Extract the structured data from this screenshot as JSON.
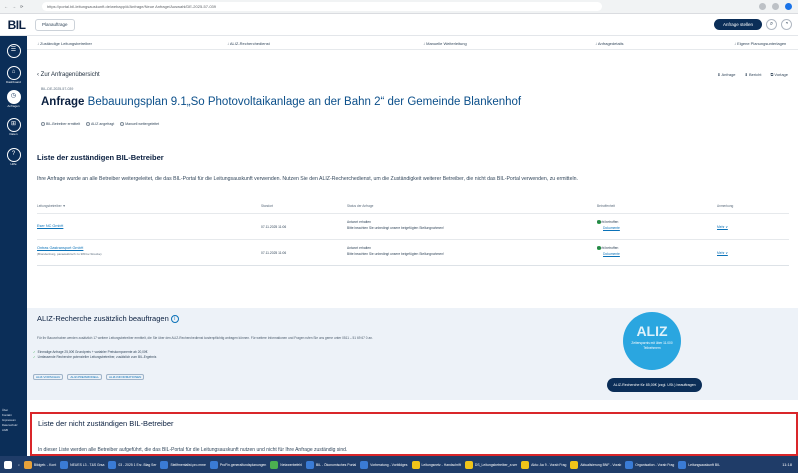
{
  "browser": {
    "url": "https://portal.bil-leitungsauskunft.de/webapp/#/Anfrage/Neue Anfrage/Auswahl/DE-2025-57-039",
    "nav_icons": [
      "←",
      "→",
      "⟳"
    ]
  },
  "app": {
    "logo": "BIL",
    "breadcrumb": "Planauftrage",
    "new_request_button": "Anfrage stellen",
    "search_icon": "search-icon",
    "user_icon": "user-icon"
  },
  "side_nav": {
    "items": [
      {
        "icon": "☰",
        "label": ""
      },
      {
        "icon": "⌂",
        "label": "Dashboard"
      },
      {
        "icon": "◷",
        "label": "Anfragen"
      },
      {
        "icon": "⊞",
        "label": "Daten"
      },
      {
        "icon": "?",
        "label": "Hilfe"
      }
    ],
    "bottom": [
      "Über",
      "Kontakt",
      "Impressum",
      "Datenschutz",
      "AGB"
    ]
  },
  "steps": [
    "↓ Zuständige Leitungsbetreiber",
    "↓ ALIZ-Recherchedienst",
    "↓ Manuelle Weiterleitung",
    "↓ Anfragedetails",
    "↓ Eigene Planungsunterlagen"
  ],
  "header": {
    "back_label": "Zur Anfragenübersicht",
    "actions": [
      "⬇ Anfrage",
      "⬇ Bericht",
      "⧉ Vorlage"
    ],
    "reference": "BIL-DE-2025-57-039",
    "title_prefix": "Anfrage",
    "title_subject": "Bebauungsplan 9.1„So Photovoltaikanlage an der Bahn 2“ der Gemeinde Blankenhof",
    "legend": [
      "BIL-Betreiber ermittelt",
      "ALIZ angefragt",
      "Manuell weitergeleitet"
    ]
  },
  "responsible": {
    "title": "Liste der zuständigen BIL-Betreiber",
    "description": "Ihre Anfrage wurde an alle Betreiber weitergeleitet, die das BIL-Portal für die Leitungsauskunft verwenden. Nutzen Sie den ALIZ-Recherchedienst, um die Zuständigkeit weiterer Betreiber, die nicht das BIL-Portal verwenden, zu ermitteln.",
    "columns": [
      "Leitungsbetreiber ▼",
      "Standort",
      "Status der Anfrage",
      "Betroffenheit",
      "Anmerkung"
    ],
    "rows": [
      {
        "operator": "Eser NC GmbH",
        "operator_sub": "",
        "date": "07.11.2025 11:06",
        "status_line1": "Antwort erhalten",
        "status_line2": "Bitte beachten Sie unbedingt unsere beigefügten Stellungnahmen!",
        "affected_label": "Nicht betroffen",
        "affected_sub": "Dokumente",
        "note": "Mehr ∨"
      },
      {
        "operator": "Ontras Gastransport GmbH",
        "operator_sub": "(Brandenburg, paraelektrisch zu 380 kv-Strecke)",
        "date": "07.11.2025 11:06",
        "status_line1": "Antwort erhalten",
        "status_line2": "Bitte beachten Sie unbedingt unsere beigefügten Stellungnahmen!",
        "affected_label": "Nicht betroffen",
        "affected_sub": "Dokumente",
        "note": "Mehr ∨"
      }
    ]
  },
  "aliz": {
    "title": "ALIZ-Recherche zusätzlich beauftragen",
    "description": "Für Ihr Bauvorhaben werden zusätzlich 17 weitere Leitungsbetreiber ermittelt, die Sie über den ALIZ-Recherchedienst kostenpflichtig anfragen können. Für weitere Informationen und Fragen rufen Sie uns gerne unter 0511 – 51 69 67 0 an.",
    "list": [
      "Einmalige Anfrage 25,00€ Grundpreis + variabler Preiskomponente ab 20,00€",
      "Umfassende Recherche potenzieller Leitungsbetreiber, zusätzlich zum BIL-Ergebnis"
    ],
    "links": [
      "ALIZ-VORSCHAU",
      "ALIZ-PREISMODELL",
      "ALIZ-INFORMATIONEN"
    ],
    "badge_big": "ALIZ",
    "badge_small": "Zeitersparnis mit über 11.000 Teilnehmern",
    "cta": "ALIZ-Recherche für 85,00€ (zzgl. USt.) beauftragen",
    "info_icon": "i"
  },
  "not_responsible": {
    "title": "Liste der nicht zuständigen BIL-Betreiber",
    "description": "In dieser Liste werden alle Betreiber aufgeführt, die das BIL-Portal für die Leitungsauskunft nutzen und nicht für Ihre Anfrage zuständig sind."
  },
  "taskbar": {
    "items": [
      {
        "label": "Bildgeb. - Kont",
        "color": "#e8a23a"
      },
      {
        "label": "NEUES L3 - T&S Grsa",
        "color": "#3a7bd5"
      },
      {
        "label": "03 - 2025 1 Erz. Blag Ser",
        "color": "#3a7bd5"
      },
      {
        "label": "Stellfmentalist.pro.mme",
        "color": "#3a7bd5"
      },
      {
        "label": "ProFin.generalfundsplanungen",
        "color": "#3a7bd5"
      },
      {
        "label": "Netzwerbefehl",
        "color": "#4caf50"
      },
      {
        "label": "BIL - Ökonomisches Portal",
        "color": "#3a7bd5"
      },
      {
        "label": "Vorberatung - Vorbildges",
        "color": "#3a7bd5"
      },
      {
        "label": "Leitungsnetz - Handschrift",
        "color": "#f0c419"
      },
      {
        "label": "DS_Leitungsbetreiber_a ser",
        "color": "#f0c419"
      },
      {
        "label": "Aktu: Aa 9 - Vorab Frag",
        "color": "#f0c419"
      },
      {
        "label": "Aktualisierung BNF - Vorab",
        "color": "#f0c419"
      },
      {
        "label": "Organisation - Vorab Frag",
        "color": "#3a7bd5"
      },
      {
        "label": "Leitungsauskunft BIL",
        "color": "#3a7bd5"
      }
    ],
    "clock": "11:18"
  }
}
